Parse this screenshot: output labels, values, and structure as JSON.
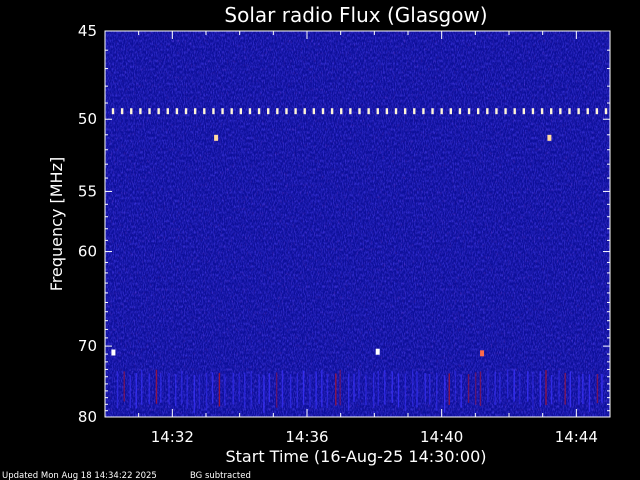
{
  "chart_data": {
    "type": "heatmap",
    "title": "Solar radio Flux (Glasgow)",
    "xlabel": "Start Time (16-Aug-25 14:30:00)",
    "ylabel": "Frequency [MHz]",
    "x_ticks": [
      "14:32",
      "14:36",
      "14:40",
      "14:44"
    ],
    "x_tick_minutes": [
      2,
      6,
      10,
      14
    ],
    "x_range_minutes": [
      0,
      15
    ],
    "y_ticks": [
      45,
      50,
      55,
      60,
      70,
      80
    ],
    "y_range": [
      45,
      80
    ],
    "y_scale": "reciprocal",
    "grid": false,
    "legend": "none",
    "colors": {
      "background": "#000000",
      "plot_base": "#0d0f9a",
      "axis": "#ffffff",
      "band_dots": "#fff5d8",
      "interference": "#a8132e",
      "vertical_streaks": "#3b33ff"
    },
    "features": {
      "band_line_freq": 49.5,
      "band_dot_count": 55,
      "bright_spots": [
        {
          "minute": 8.1,
          "freq": 70.7,
          "color": "#ffffff"
        },
        {
          "minute": 3.3,
          "freq": 51.2,
          "color": "#ffd8a0"
        },
        {
          "minute": 13.2,
          "freq": 51.2,
          "color": "#ffd8a0"
        },
        {
          "minute": 0.25,
          "freq": 70.8,
          "color": "#ffffff"
        },
        {
          "minute": 11.2,
          "freq": 70.9,
          "color": "#ff6a4a"
        }
      ],
      "streak_band": [
        73,
        78.5
      ]
    }
  },
  "footer": {
    "updated": "Updated Mon Aug 18 14:34:22 2025",
    "note": "BG subtracted"
  }
}
